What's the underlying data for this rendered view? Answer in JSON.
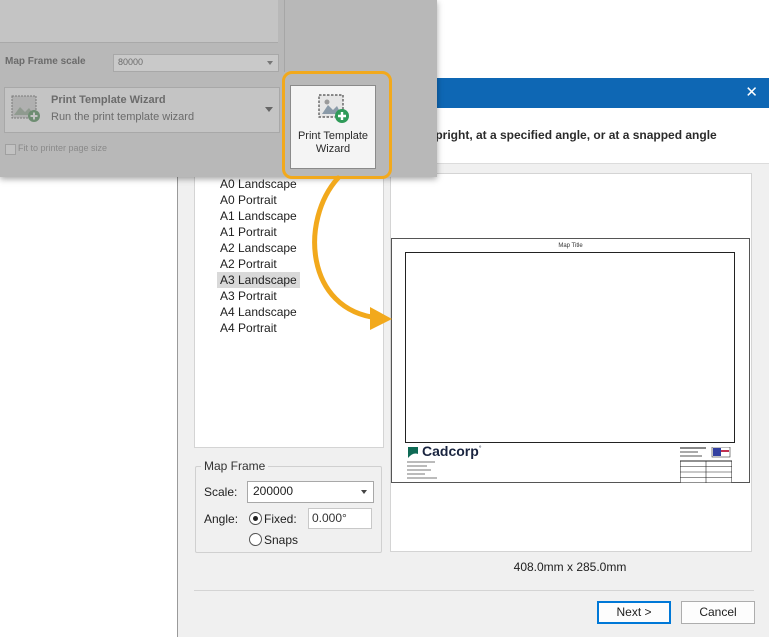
{
  "ribbon": {
    "scale_label": "Map Frame scale",
    "scale_value": "80000",
    "wizard_title": "Print Template Wizard",
    "wizard_description": "Run the print template wizard",
    "fit_checkbox_label": "Fit to printer page size",
    "highlight_button_label_line1": "Print Template",
    "highlight_button_label_line2": "Wizard",
    "highlight_color": "#f2a91c"
  },
  "dialog": {
    "close_glyph": "✕",
    "subtitle": "upright, at a specified angle, or at a snapped angle",
    "titlebar_color": "#0e67b4",
    "templates": [
      {
        "label": "A0 Landscape",
        "selected": false
      },
      {
        "label": "A0 Portrait",
        "selected": false
      },
      {
        "label": "A1 Landscape",
        "selected": false
      },
      {
        "label": "A1 Portrait",
        "selected": false
      },
      {
        "label": "A2 Landscape",
        "selected": false
      },
      {
        "label": "A2 Portrait",
        "selected": false
      },
      {
        "label": "A3 Landscape",
        "selected": true
      },
      {
        "label": "A3 Portrait",
        "selected": false
      },
      {
        "label": "A4 Landscape",
        "selected": false
      },
      {
        "label": "A4 Portrait",
        "selected": false
      }
    ],
    "preview": {
      "map_title": "Map Title",
      "logo_text": "Cadcorp",
      "logo_mark": "°"
    },
    "page_size": "408.0mm x 285.0mm",
    "map_frame": {
      "legend": "Map Frame",
      "scale_label": "Scale:",
      "scale_value": "200000",
      "angle_label": "Angle:",
      "fixed_label": "Fixed:",
      "fixed_selected": true,
      "angle_value": "0.000°",
      "snaps_label": "Snaps",
      "snaps_selected": false
    },
    "buttons": {
      "next": "Next >",
      "cancel": "Cancel"
    }
  }
}
